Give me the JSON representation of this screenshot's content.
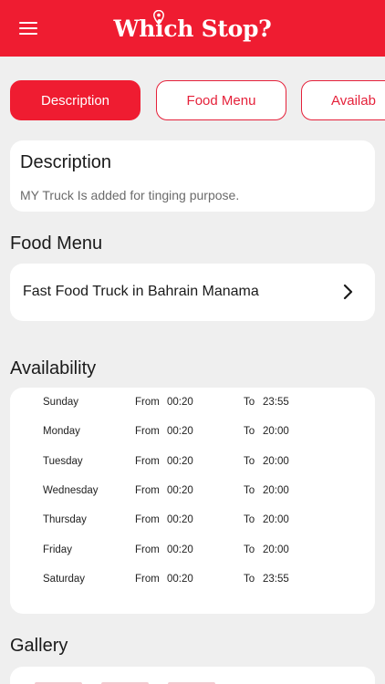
{
  "header": {
    "title": "Which Stop?",
    "menu_icon": "hamburger-menu-icon",
    "pin_icon": "location-pin-icon",
    "brand_color": "#ef1c31"
  },
  "tabs": [
    {
      "label": "Description",
      "active": true
    },
    {
      "label": "Food Menu",
      "active": false
    },
    {
      "label": "Availab",
      "active": false
    }
  ],
  "description": {
    "title": "Description",
    "text": "MY Truck Is added for tinging purpose."
  },
  "food_menu": {
    "title": "Food Menu",
    "item": "Fast Food Truck in Bahrain Manama",
    "item_icon": "chevron-right-icon"
  },
  "availability": {
    "title": "Availability",
    "from_label": "From",
    "to_label": "To",
    "days": [
      {
        "day": "Sunday",
        "from": "00:20",
        "to": "23:55"
      },
      {
        "day": "Monday",
        "from": "00:20",
        "to": "20:00"
      },
      {
        "day": "Tuesday",
        "from": "00:20",
        "to": "20:00"
      },
      {
        "day": "Wednesday",
        "from": "00:20",
        "to": "20:00"
      },
      {
        "day": "Thursday",
        "from": "00:20",
        "to": "20:00"
      },
      {
        "day": "Friday",
        "from": "00:20",
        "to": "20:00"
      },
      {
        "day": "Saturday",
        "from": "00:20",
        "to": "23:55"
      }
    ]
  },
  "gallery": {
    "title": "Gallery"
  }
}
